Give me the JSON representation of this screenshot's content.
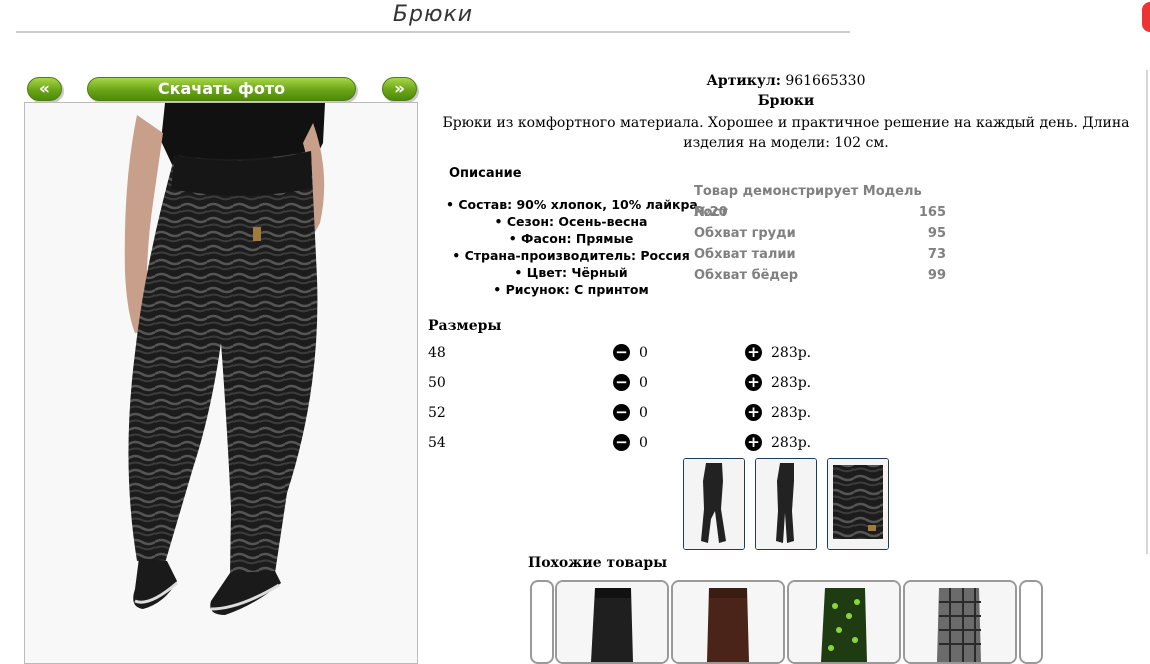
{
  "header": {
    "title": "Брюки"
  },
  "gallery": {
    "prev_label": "«",
    "download_label": "Скачать фото",
    "next_label": "»"
  },
  "product": {
    "article_label": "Артикул:",
    "article_value": "961665330",
    "name": "Брюки",
    "description": "Брюки из комфортного материала. Хорошее и практичное решение на каждый день. Длина изделия на модели: 102 см."
  },
  "details": {
    "heading": "Описание",
    "items": [
      "Состав: 90% хлопок, 10% лайкра",
      "Сезон: Осень-весна",
      "Фасон: Прямые",
      "Страна-производитель: Россия",
      "Цвет: Чёрный",
      "Рисунок: С принтом"
    ]
  },
  "model": {
    "heading": "Товар демонстрирует Модель №20",
    "rows": [
      {
        "label": "Рост",
        "value": "165"
      },
      {
        "label": "Обхват груди",
        "value": "95"
      },
      {
        "label": "Обхват талии",
        "value": "73"
      },
      {
        "label": "Обхват бёдер",
        "value": "99"
      }
    ]
  },
  "sizes": {
    "heading": "Размеры",
    "minus_icon": "minus-circle-icon",
    "plus_icon": "plus-circle-icon",
    "rows": [
      {
        "size": "48",
        "qty": "0",
        "price": "283р."
      },
      {
        "size": "50",
        "qty": "0",
        "price": "283р."
      },
      {
        "size": "52",
        "qty": "0",
        "price": "283р."
      },
      {
        "size": "54",
        "qty": "0",
        "price": "283р."
      }
    ]
  },
  "similar": {
    "heading": "Похожие товары"
  },
  "colors": {
    "button_green": "#6aa516",
    "thumb_border": "#1d3b5a",
    "model_text": "#808080"
  }
}
